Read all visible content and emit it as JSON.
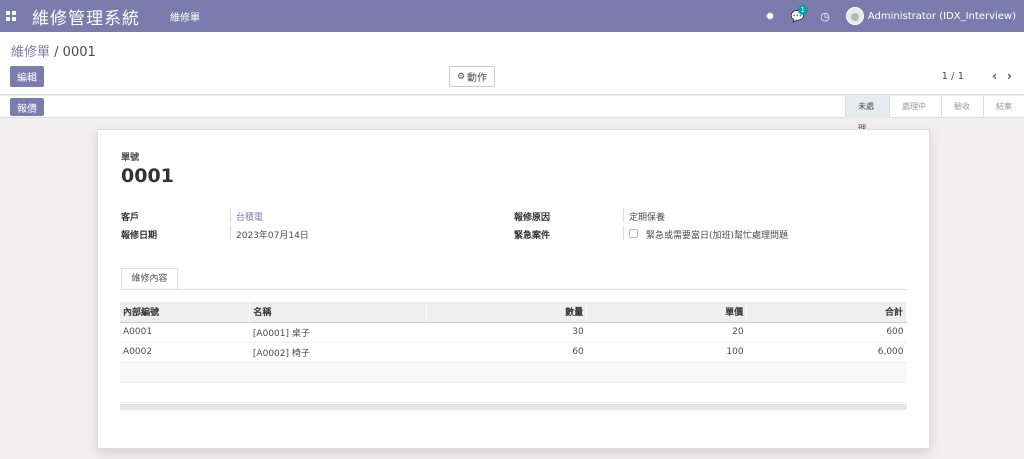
{
  "app": {
    "title": "維修管理系統",
    "menu_item": "維修單",
    "user": "Administrator (IDX_Interview)",
    "chat_count": "1"
  },
  "breadcrumb": {
    "parent": "維修單",
    "separator": " / ",
    "current": "0001"
  },
  "toolbar": {
    "edit_label": "編輯",
    "action_label": "動作"
  },
  "pager": {
    "value": "1 / 1",
    "prev": "‹",
    "next": "›"
  },
  "statusbar": {
    "quote_label": "報價",
    "stages": [
      "未處理",
      "處理中",
      "驗收",
      "結案"
    ],
    "active_stage": "未處理"
  },
  "record": {
    "number_label": "單號",
    "number": "0001",
    "customer_label": "客戶",
    "customer": "台積電",
    "date_label": "報修日期",
    "date": "2023年07月14日",
    "reason_label": "報修原因",
    "reason": "定期保養",
    "urgent_label": "緊急案件",
    "urgent_text": "緊急或需要當日(加班)幫忙處理問題",
    "urgent_checked": false
  },
  "notebook": {
    "tab_label": "維修內容"
  },
  "lines": {
    "columns": [
      "內部編號",
      "名稱",
      "數量",
      "單價",
      "合計"
    ],
    "rows": [
      [
        "A0001",
        "[A0001] 桌子",
        "30",
        "20",
        "600"
      ],
      [
        "A0002",
        "[A0002] 椅子",
        "60",
        "100",
        "6,000"
      ]
    ]
  },
  "colors": {
    "brand": "#7c7bad",
    "link": "#7c7bad"
  }
}
